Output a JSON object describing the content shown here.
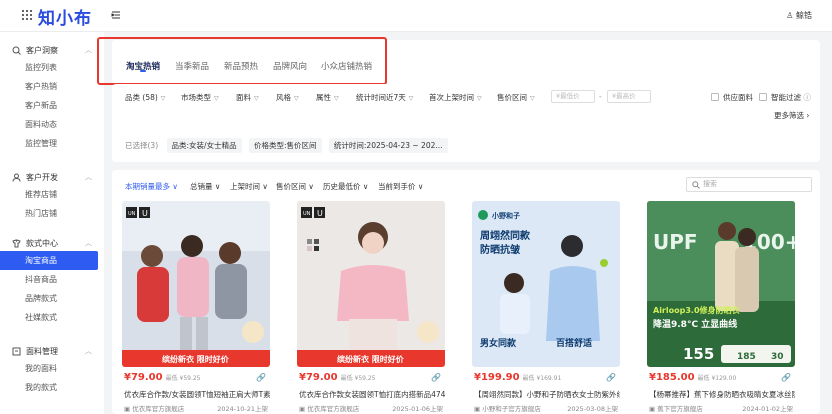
{
  "app": {
    "logo": "知小布",
    "user": "鲸锆"
  },
  "sidebar": {
    "groups": [
      {
        "title": "客户洞察",
        "items": [
          "监控列表",
          "客户热销",
          "客户新品",
          "面料动态",
          "监控管理"
        ]
      },
      {
        "title": "客户开发",
        "items": [
          "推荐店铺",
          "热门店铺"
        ]
      },
      {
        "title": "款式中心",
        "items": [
          "淘宝商品",
          "抖音商品",
          "品牌款式",
          "社媒款式"
        ]
      },
      {
        "title": "面料管理",
        "items": [
          "我的面料",
          "我的款式"
        ]
      }
    ],
    "active_item": "淘宝商品"
  },
  "tabs": [
    "淘宝热销",
    "当季新品",
    "新品预热",
    "品牌风向",
    "小众店铺热销"
  ],
  "filters": {
    "category": "品类",
    "category_count": "(58)",
    "market": "市场类型",
    "fabric": "面料",
    "style": "风格",
    "attr": "属性",
    "stat_time": "统计时间近7天",
    "first_listed": "首次上架时间",
    "price_range": "售价区间",
    "min_price": "¥最低价",
    "max_price": "¥最高价",
    "dash": "-",
    "supply_fabric": "供应面料",
    "smart_filter": "智能过滤",
    "more": "更多筛选",
    "selected_label": "已选择(3)",
    "selected_tags": [
      "品类:女装/女士精品",
      "价格类型:售价区间",
      "统计时间:2025-04-23 ~ 202..."
    ]
  },
  "sort": {
    "items": [
      "本期销量最多",
      "总销量",
      "上架时间",
      "售价区间",
      "历史最低价",
      "当前到手价"
    ],
    "search_placeholder": "搜索"
  },
  "products": [
    {
      "price": "¥79.00",
      "orig": "最低 ¥59.25",
      "title": "优衣库合作款/女装圆领T恤短袖正肩大师T素...",
      "shop": "优衣库官方旗舰店",
      "date": "2024-10-21上架",
      "brand": "UNIQLO U",
      "banner": "缤纷新衣 限时好价"
    },
    {
      "price": "¥79.00",
      "orig": "最低 ¥59.25",
      "title": "优衣库合作款女装圆领T恤打底内搭新品474408",
      "shop": "优衣库官方旗舰店",
      "date": "2025-01-06上架",
      "brand": "UNIQLO U",
      "banner": "缤纷新衣 限时好价"
    },
    {
      "price": "¥199.90",
      "orig": "最低 ¥169.91",
      "title": "【周翊然同款】小野和子防晒衣女士防紫外线...",
      "shop": "小野和子官方旗舰店",
      "date": "2025-03-08上架",
      "brand": "小野和子",
      "banner": "周翊然同款 防晒抗皱"
    },
    {
      "price": "¥185.00",
      "orig": "最低 ¥129.00",
      "title": "【杨幂推荐】蕉下修身防晒衣吸睛女夏冰丝防...",
      "shop": "蕉下官方旗舰店",
      "date": "2024-01-02上架",
      "brand": "UPF100+",
      "banner": "降温9.8°C 立显曲线"
    }
  ],
  "colors": {
    "accent": "#2e5bf2",
    "price": "#e8372c",
    "highlight_box": "#e8372c"
  }
}
